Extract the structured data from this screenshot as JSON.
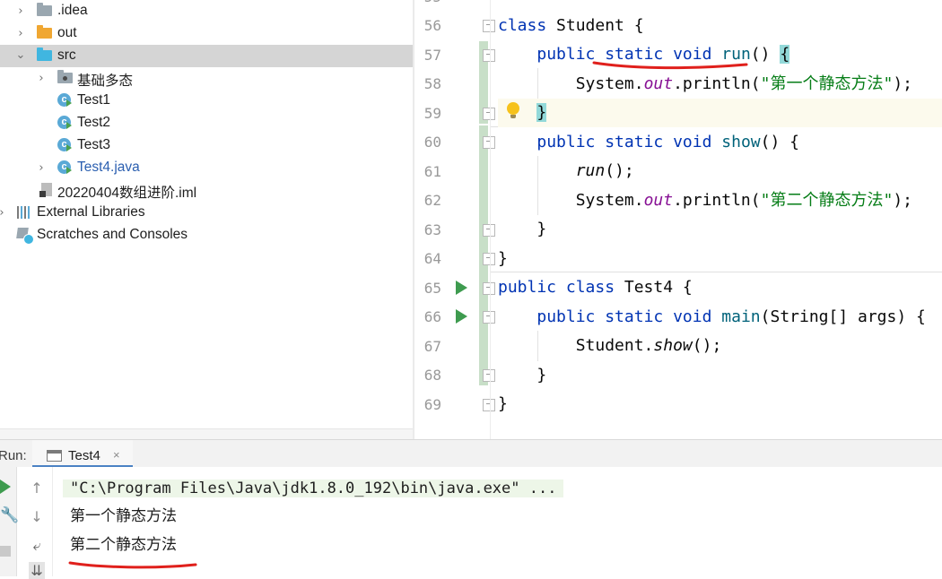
{
  "project_tree": {
    "items": [
      {
        "label": ".idea",
        "icon": "folder-icon",
        "expanded": false
      },
      {
        "label": "out",
        "icon": "folder-orange-icon",
        "expanded": false
      },
      {
        "label": "src",
        "icon": "source-folder-icon",
        "expanded": true,
        "selected": true
      },
      {
        "label": "基础多态",
        "icon": "package-icon",
        "expanded": false
      },
      {
        "label": "Test1",
        "icon": "java-class-icon"
      },
      {
        "label": "Test2",
        "icon": "java-class-icon"
      },
      {
        "label": "Test3",
        "icon": "java-class-icon"
      },
      {
        "label": "Test4.java",
        "icon": "java-class-icon",
        "expanded": false
      },
      {
        "label": "20220404数组进阶.iml",
        "icon": "module-file-icon"
      },
      {
        "label": "External Libraries",
        "icon": "libraries-icon",
        "expanded": false
      },
      {
        "label": "Scratches and Consoles",
        "icon": "scratches-icon"
      }
    ]
  },
  "editor": {
    "top_partial_line": {
      "number": "55",
      "text": "*/"
    },
    "line_numbers": [
      "56",
      "57",
      "58",
      "59",
      "60",
      "61",
      "62",
      "63",
      "64",
      "65",
      "66",
      "67",
      "68",
      "69"
    ],
    "code": {
      "l56": {
        "kw": "class",
        "name": " Student {"
      },
      "l57": {
        "kw": "public static void",
        "fn": "run",
        "rest": "() ",
        "brace": "{"
      },
      "l58": {
        "pre": "System.",
        "field": "out",
        "mid": ".println(",
        "str": "\"第一个静态方法\"",
        "end": ");"
      },
      "l59": {
        "brace": "}"
      },
      "l60": {
        "kw": "public static void",
        "fn": "show",
        "rest": "() {"
      },
      "l61": {
        "call": "run",
        "rest": "();"
      },
      "l62": {
        "pre": "System.",
        "field": "out",
        "mid": ".println(",
        "str": "\"第二个静态方法\"",
        "end": ");"
      },
      "l63": {
        "text": "}"
      },
      "l64": {
        "text": "}"
      },
      "l65": {
        "kw": "public class",
        "name": " Test4 {"
      },
      "l66": {
        "kw": "public static void",
        "fn": "main",
        "rest": "(String[] args) {"
      },
      "l67": {
        "pre": "Student.",
        "call": "show",
        "rest": "();"
      },
      "l68": {
        "text": "}"
      },
      "l69": {
        "text": "}"
      }
    }
  },
  "run_panel": {
    "label": "Run:",
    "tab_label": "Test4",
    "tab_close": "×",
    "output": [
      "\"C:\\Program Files\\Java\\jdk1.8.0_192\\bin\\java.exe\" ...",
      "第一个静态方法",
      "第二个静态方法"
    ]
  },
  "colors": {
    "keyword": "#0033b3",
    "method": "#00627a",
    "static_field": "#871094",
    "string": "#067d17",
    "annotation_underline": "#e0201c",
    "selection": "#d5d5d5"
  }
}
